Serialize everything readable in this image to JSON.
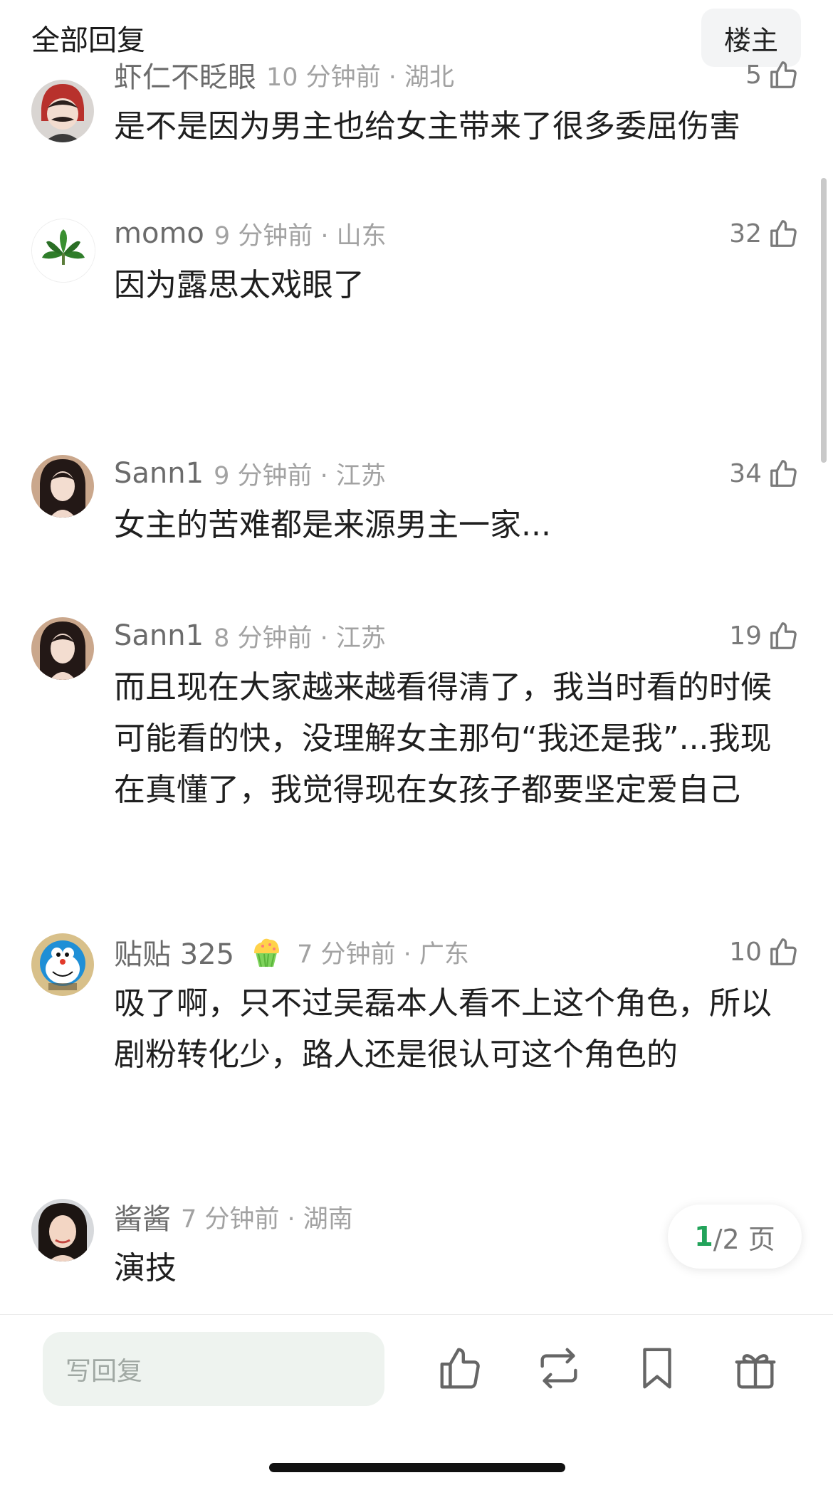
{
  "header": {
    "title": "全部回复",
    "owner_button": "楼主"
  },
  "comments": [
    {
      "username": "虾仁不眨眼",
      "time_location": "10 分钟前 · 湖北",
      "likes": "5",
      "text": "是不是因为男主也给女主带来了很多委屈伤害"
    },
    {
      "username": "momo",
      "time_location": "9 分钟前 · 山东",
      "likes": "32",
      "text": "因为露思太戏眼了"
    },
    {
      "username": "Sann1",
      "time_location": "9 分钟前 · 江苏",
      "likes": "34",
      "text": "女主的苦难都是来源男主一家..."
    },
    {
      "username": "Sann1",
      "time_location": "8 分钟前 · 江苏",
      "likes": "19",
      "text": "而且现在大家越来越看得清了，我当时看的时候可能看的快，没理解女主那句“我还是我”...我现在真懂了，我觉得现在女孩子都要坚定爱自己"
    },
    {
      "username": "贴贴 325",
      "time_location": "7 分钟前 · 广东",
      "likes": "10",
      "text": "吸了啊，只不过吴磊本人看不上这个角色，所以剧粉转化少，路人还是很认可这个角色的",
      "medal_icon": "cupcake-icon"
    },
    {
      "username": "酱酱",
      "time_location": "7 分钟前 · 湖南",
      "likes": "",
      "text": "演技"
    }
  ],
  "pager": {
    "current": "1",
    "total_suffix": "/2 页"
  },
  "bottom_bar": {
    "reply_placeholder": "写回复"
  },
  "colors": {
    "accent": "#22a35a",
    "input_bg": "#eef3ef",
    "muted": "#a2a2a2"
  }
}
